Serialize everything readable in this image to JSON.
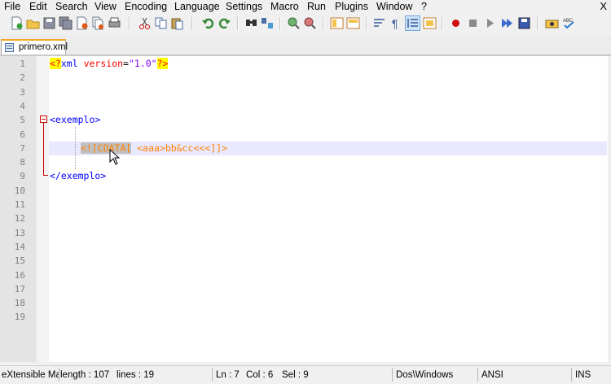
{
  "menu": {
    "items": [
      "File",
      "Edit",
      "Search",
      "View",
      "Encoding",
      "Language",
      "Settings",
      "Macro",
      "Run",
      "Plugins",
      "Window",
      "?"
    ],
    "close_glyph": "X"
  },
  "toolbar": {
    "buttons": [
      "new-file",
      "open-file",
      "save",
      "save-all",
      "close",
      "close-all",
      "print",
      "cut",
      "copy",
      "paste",
      "undo",
      "redo",
      "find",
      "replace",
      "zoom-in",
      "zoom-out",
      "sync-vertical",
      "sync-horizontal",
      "word-wrap",
      "show-all-characters",
      "indent-guide",
      "user-defined-language",
      "start-recording",
      "stop-recording",
      "playback",
      "run-macro-multiple",
      "save-macro",
      "trim",
      "spell-check"
    ]
  },
  "tabs": [
    {
      "label": "primero.xml",
      "icon": "file-icon",
      "active": true
    }
  ],
  "editor": {
    "line_numbers": [
      "1",
      "2",
      "3",
      "4",
      "5",
      "6",
      "7",
      "8",
      "9",
      "10",
      "11",
      "12",
      "13",
      "14",
      "15",
      "16",
      "17",
      "18",
      "19"
    ],
    "line1": {
      "open": "<?",
      "name": "xml",
      "attr": "version",
      "eq": "=",
      "value": "\"1.0\"",
      "close": "?>"
    },
    "line5": {
      "tag": "<exemplo>"
    },
    "line7": {
      "cdata_open": "<![CDATA[",
      "content": " <aaa>bb&cc<<<]]>"
    },
    "line9": {
      "tag": "</exemplo>"
    },
    "current_line": 7
  },
  "status": {
    "file_type": "eXtensible Ma",
    "length": "length : 107",
    "lines": "lines : 19",
    "ln": "Ln : 7",
    "col": "Col : 6",
    "sel": "Sel : 9",
    "eol": "Dos\\Windows",
    "encoding": "ANSI",
    "mode": "INS"
  }
}
